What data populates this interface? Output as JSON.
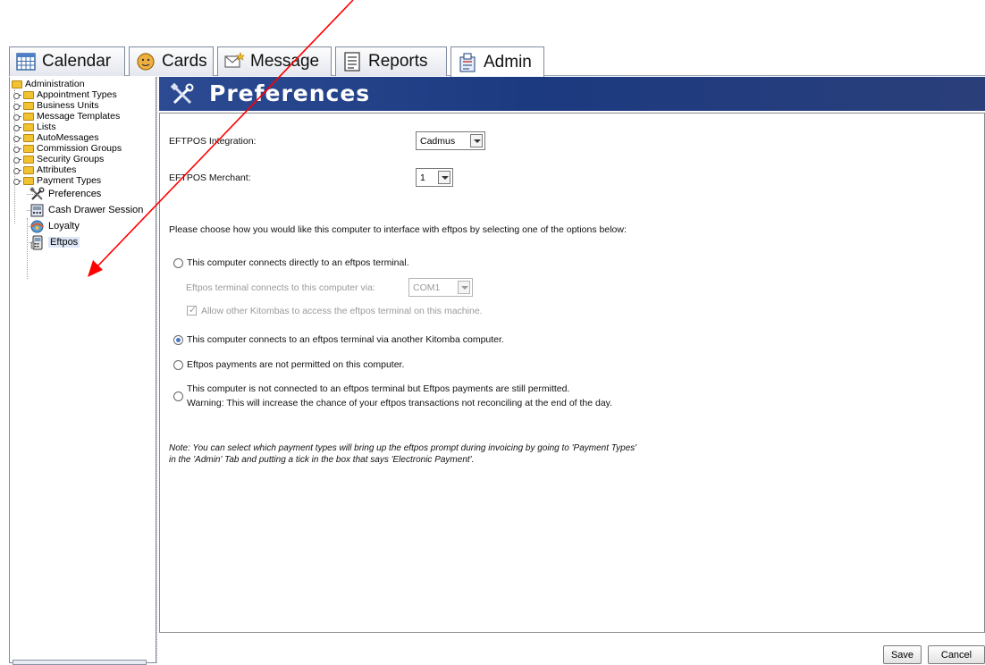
{
  "tabs": [
    {
      "label": "Calendar",
      "icon": "calendar-icon"
    },
    {
      "label": "Cards",
      "icon": "face-icon"
    },
    {
      "label": "Message",
      "icon": "message-icon"
    },
    {
      "label": "Reports",
      "icon": "reports-icon"
    },
    {
      "label": "Admin",
      "icon": "admin-icon",
      "active": true
    }
  ],
  "tree": {
    "root": "Administration",
    "folders": [
      "Appointment Types",
      "Business Units",
      "Message Templates",
      "Lists",
      "AutoMessages",
      "Commission Groups",
      "Security Groups",
      "Attributes",
      "Payment Types"
    ],
    "leaves": [
      {
        "label": "Preferences",
        "icon": "tools-icon"
      },
      {
        "label": "Cash Drawer Session",
        "icon": "cash-drawer-icon"
      },
      {
        "label": "Loyalty",
        "icon": "loyalty-icon"
      },
      {
        "label": "Eftpos",
        "icon": "eftpos-icon",
        "selected": true
      }
    ]
  },
  "header": {
    "title": "Preferences",
    "icon": "tools-icon"
  },
  "form": {
    "integration_label": "EFTPOS Integration:",
    "integration_value": "Cadmus",
    "merchant_label": "EFTPOS Merchant:",
    "merchant_value": "1",
    "instructions": "Please choose how you would like this computer to interface with eftpos by selecting one of the options below:",
    "options": [
      {
        "label": "This computer connects directly to an eftpos terminal.",
        "checked": false
      },
      {
        "label": "This computer connects to an eftpos terminal via another Kitomba computer.",
        "checked": true
      },
      {
        "label": "Eftpos payments are not permitted on this computer.",
        "checked": false
      },
      {
        "label": "This computer is not connected to an eftpos terminal but Eftpos payments are still permitted.",
        "checked": false
      }
    ],
    "option4_warning": "Warning: This will increase the chance of your eftpos transactions not reconciling at the end of the day.",
    "sub_connect_label": "Eftpos terminal connects to this computer via:",
    "sub_connect_value": "COM1",
    "sub_allow_label": "Allow other Kitombas to access the eftpos terminal on this machine.",
    "note_line1": "Note: You can select which payment types will bring up the eftpos prompt during invoicing by going to 'Payment Types'",
    "note_line2": "in the 'Admin' Tab and putting a tick in the box that says 'Electronic Payment'."
  },
  "buttons": {
    "save": "Save",
    "cancel": "Cancel"
  },
  "colors": {
    "banner": "#1c3a80",
    "annotation_arrow": "#ff0000",
    "radio_selected": "#4a78c8"
  }
}
